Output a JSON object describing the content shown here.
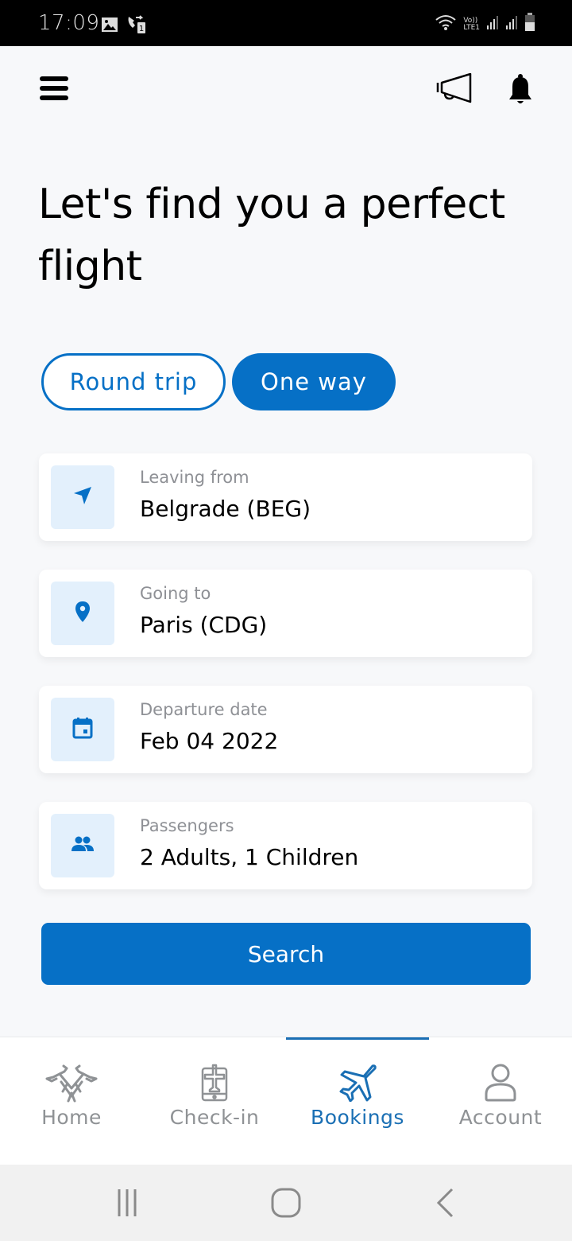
{
  "status_bar": {
    "time": "17:09",
    "left_icons": [
      "gallery-icon",
      "call-forward-icon"
    ],
    "right_icons": [
      "wifi-icon",
      "volte-lte-icon",
      "signal-icon",
      "signal-icon",
      "battery-icon"
    ],
    "lte_label_top": "Vo))",
    "lte_label_bottom": "LTE1"
  },
  "header": {
    "menu_icon": "hamburger-menu-icon",
    "actions": [
      "megaphone-icon",
      "bell-icon"
    ]
  },
  "page_title": "Let's find you a perfect flight",
  "trip_type": {
    "options": [
      {
        "label": "Round trip",
        "selected": false
      },
      {
        "label": "One way",
        "selected": true
      }
    ]
  },
  "fields": [
    {
      "icon": "navigation-arrow-icon",
      "label": "Leaving from",
      "value": "Belgrade (BEG)"
    },
    {
      "icon": "location-pin-icon",
      "label": "Going to",
      "value": "Paris (CDG)"
    },
    {
      "icon": "calendar-icon",
      "label": "Departure date",
      "value": "Feb 04 2022"
    },
    {
      "icon": "people-icon",
      "label": "Passengers",
      "value": "2 Adults, 1 Children"
    }
  ],
  "search_button": {
    "label": "Search"
  },
  "bottom_nav": {
    "items": [
      {
        "label": "Home",
        "icon": "eagle-logo-icon",
        "active": false
      },
      {
        "label": "Check-in",
        "icon": "mobile-boarding-icon",
        "active": false
      },
      {
        "label": "Bookings",
        "icon": "airplane-icon",
        "active": true
      },
      {
        "label": "Account",
        "icon": "user-icon",
        "active": false
      }
    ]
  },
  "system_nav": [
    "recents-icon",
    "home-icon",
    "back-icon"
  ],
  "colors": {
    "accent": "#0670c6",
    "nav_active": "#1a6fb4",
    "icon_bg": "#e3f0fc",
    "label_gray": "#8e9095",
    "background": "#f7f8fa"
  }
}
